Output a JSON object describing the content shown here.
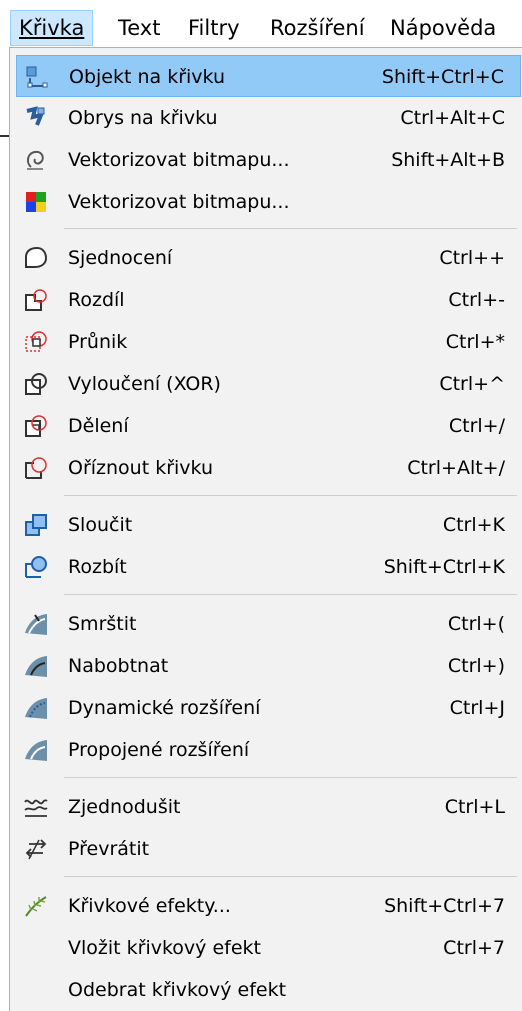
{
  "menubar": {
    "items": [
      {
        "label": "Křivka",
        "active": true
      },
      {
        "label": "Text",
        "active": false
      },
      {
        "label": "Filtry",
        "active": false
      },
      {
        "label": "Rozšíření",
        "active": false
      },
      {
        "label": "Nápověda",
        "active": false
      }
    ]
  },
  "menu": {
    "items": [
      {
        "label": "Objekt na křivku",
        "shortcut": "Shift+Ctrl+C",
        "icon": "object-to-path-icon",
        "highlighted": true
      },
      {
        "label": "Obrys na křivku",
        "shortcut": "Ctrl+Alt+C",
        "icon": "stroke-to-path-icon"
      },
      {
        "label": "Vektorizovat bitmapu...",
        "shortcut": "Shift+Alt+B",
        "icon": "trace-bitmap-icon"
      },
      {
        "label": "Vektorizovat bitmapu...",
        "shortcut": "",
        "icon": "trace-pixel-art-icon"
      },
      {
        "label": "Sjednocení",
        "shortcut": "Ctrl++",
        "icon": "path-union-icon"
      },
      {
        "label": "Rozdíl",
        "shortcut": "Ctrl+-",
        "icon": "path-difference-icon"
      },
      {
        "label": "Průnik",
        "shortcut": "Ctrl+*",
        "icon": "path-intersection-icon"
      },
      {
        "label": "Vyloučení (XOR)",
        "shortcut": "Ctrl+^",
        "icon": "path-exclusion-icon"
      },
      {
        "label": "Dělení",
        "shortcut": "Ctrl+/",
        "icon": "path-division-icon"
      },
      {
        "label": "Oříznout křivku",
        "shortcut": "Ctrl+Alt+/",
        "icon": "path-cut-icon"
      },
      {
        "label": "Sloučit",
        "shortcut": "Ctrl+K",
        "icon": "path-combine-icon"
      },
      {
        "label": "Rozbít",
        "shortcut": "Shift+Ctrl+K",
        "icon": "path-break-apart-icon"
      },
      {
        "label": "Smrštit",
        "shortcut": "Ctrl+(",
        "icon": "path-inset-icon"
      },
      {
        "label": "Nabobtnat",
        "shortcut": "Ctrl+)",
        "icon": "path-outset-icon"
      },
      {
        "label": "Dynamické rozšíření",
        "shortcut": "Ctrl+J",
        "icon": "path-offset-dynamic-icon"
      },
      {
        "label": "Propojené rozšíření",
        "shortcut": "",
        "icon": "path-offset-linked-icon"
      },
      {
        "label": "Zjednodušit",
        "shortcut": "Ctrl+L",
        "icon": "path-simplify-icon"
      },
      {
        "label": "Převrátit",
        "shortcut": "",
        "icon": "path-reverse-icon"
      },
      {
        "label": "Křivkové efekty...",
        "shortcut": "Shift+Ctrl+7",
        "icon": "path-effects-icon"
      },
      {
        "label": "Vložit křivkový efekt",
        "shortcut": "Ctrl+7",
        "icon": ""
      },
      {
        "label": "Odebrat křivkový efekt",
        "shortcut": "",
        "icon": ""
      }
    ]
  },
  "colors": {
    "highlight": "#91c9f7",
    "menu_background": "#f2f2f2",
    "active_menubar": "#cce8ff"
  }
}
